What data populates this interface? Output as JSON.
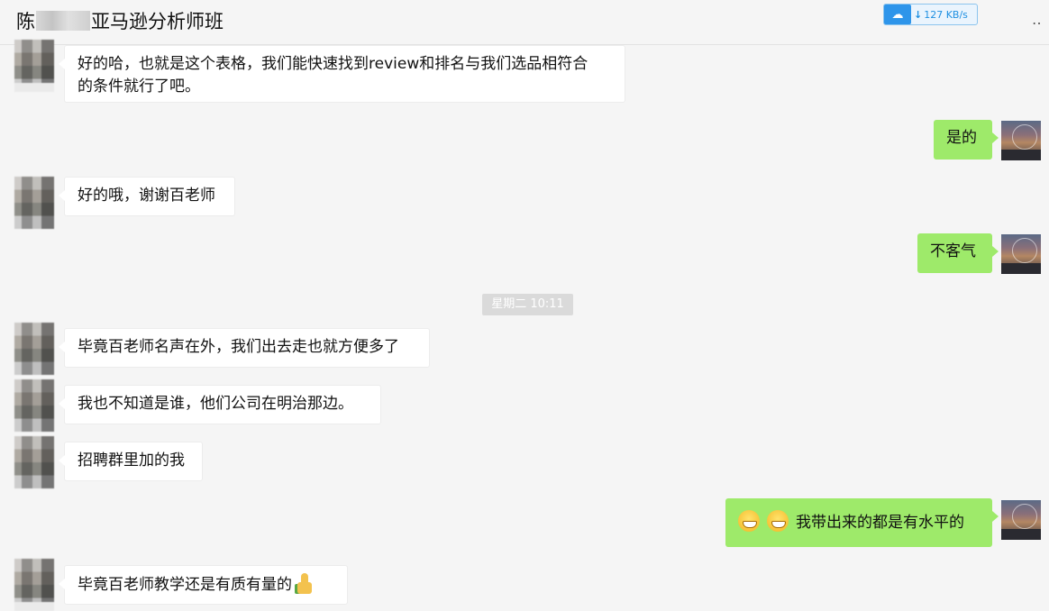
{
  "header": {
    "title_prefix": "陈",
    "title_suffix": "亚马逊分析师班",
    "net_speed": "127 KB/s"
  },
  "timestamp": "星期二 10:11",
  "messages": [
    {
      "side": "left",
      "text_line1": "好的哈，也就是这个表格，我们能快速找到review和排名与我们选品相符合",
      "text_line2": "的条件就行了吧。"
    },
    {
      "side": "right",
      "text": "是的"
    },
    {
      "side": "left",
      "text": "好的哦，谢谢百老师"
    },
    {
      "side": "right",
      "text": "不客气"
    },
    {
      "side": "left",
      "text": "毕竟百老师名声在外，我们出去走也就方便多了"
    },
    {
      "side": "left",
      "text": "我也不知道是谁，他们公司在明治那边。"
    },
    {
      "side": "left",
      "text": "招聘群里加的我"
    },
    {
      "side": "right",
      "text": "我带出来的都是有水平的"
    },
    {
      "side": "left",
      "text": "毕竟百老师教学还是有质有量的"
    }
  ]
}
